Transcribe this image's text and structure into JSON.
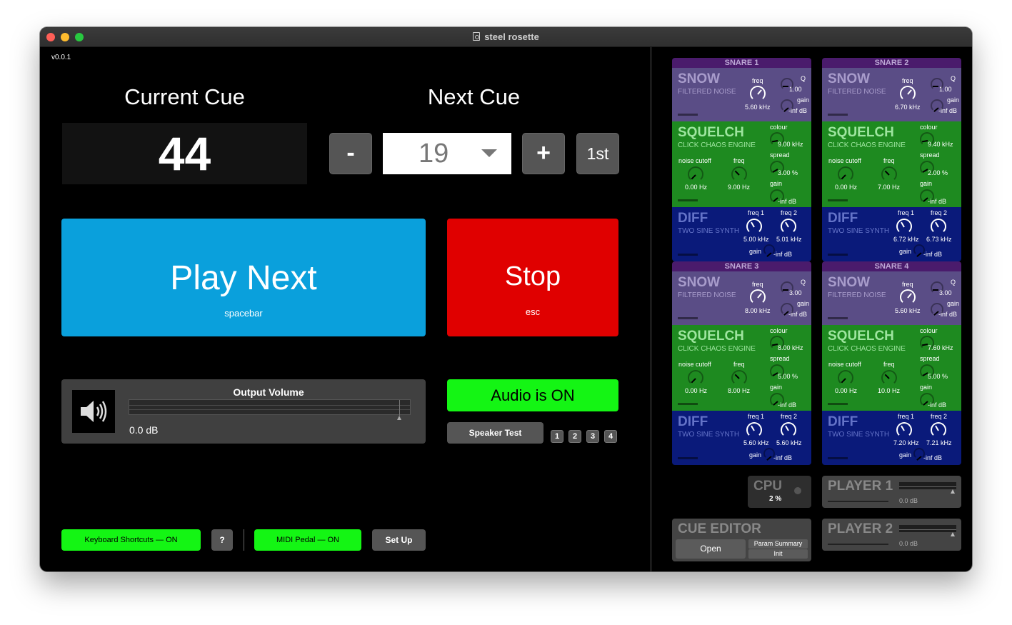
{
  "window": {
    "title": "steel rosette",
    "version": "v0.0.1"
  },
  "cues": {
    "current_label": "Current Cue",
    "next_label": "Next Cue",
    "current_value": "44",
    "next_value": "19",
    "minus_label": "-",
    "plus_label": "+",
    "first_label": "1st"
  },
  "transport": {
    "play_label": "Play Next",
    "play_hint": "spacebar",
    "stop_label": "Stop",
    "stop_hint": "esc"
  },
  "output": {
    "title": "Output Volume",
    "value": "0.0 dB"
  },
  "audio": {
    "status": "Audio is ON",
    "speaker_test": "Speaker Test",
    "channels": [
      "1",
      "2",
      "3",
      "4"
    ]
  },
  "bottom": {
    "keyboard": "Keyboard Shortcuts — ON",
    "help": "?",
    "midi": "MIDI Pedal — ON",
    "setup": "Set Up"
  },
  "snares": [
    {
      "header": "SNARE 1",
      "snow": {
        "title": "SNOW",
        "sub": "FILTERED NOISE",
        "freq_label": "freq",
        "freq": "5.60 kHz",
        "q_label": "Q",
        "q": "1.00",
        "gain_label": "gain",
        "gain": "-inf dB"
      },
      "squelch": {
        "title": "SQUELCH",
        "sub": "CLICK CHAOS ENGINE",
        "colour_label": "colour",
        "colour": "9.00 kHz",
        "noise_label": "noise cutoff",
        "noise": "0.00 Hz",
        "freq_label": "freq",
        "freq": "9.00 Hz",
        "spread_label": "spread",
        "spread": "3.00 %",
        "gain_label": "gain",
        "gain": "-inf dB"
      },
      "diff": {
        "title": "DIFF",
        "sub": "TWO SINE SYNTH",
        "f1_label": "freq 1",
        "f1": "5.00 kHz",
        "f2_label": "freq 2",
        "f2": "5.01 kHz",
        "gain_label": "gain",
        "gain": "-inf dB"
      }
    },
    {
      "header": "SNARE 2",
      "snow": {
        "title": "SNOW",
        "sub": "FILTERED NOISE",
        "freq_label": "freq",
        "freq": "6.70 kHz",
        "q_label": "Q",
        "q": "1.00",
        "gain_label": "gain",
        "gain": "-inf dB"
      },
      "squelch": {
        "title": "SQUELCH",
        "sub": "CLICK CHAOS ENGINE",
        "colour_label": "colour",
        "colour": "9.40 kHz",
        "noise_label": "noise cutoff",
        "noise": "0.00 Hz",
        "freq_label": "freq",
        "freq": "7.00 Hz",
        "spread_label": "spread",
        "spread": "2.00 %",
        "gain_label": "gain",
        "gain": "-inf dB"
      },
      "diff": {
        "title": "DIFF",
        "sub": "TWO SINE SYNTH",
        "f1_label": "freq 1",
        "f1": "6.72 kHz",
        "f2_label": "freq 2",
        "f2": "6.73 kHz",
        "gain_label": "gain",
        "gain": "-inf dB"
      }
    },
    {
      "header": "SNARE 3",
      "snow": {
        "title": "SNOW",
        "sub": "FILTERED NOISE",
        "freq_label": "freq",
        "freq": "8.00 kHz",
        "q_label": "Q",
        "q": "3.00",
        "gain_label": "gain",
        "gain": "-inf dB"
      },
      "squelch": {
        "title": "SQUELCH",
        "sub": "CLICK CHAOS ENGINE",
        "colour_label": "colour",
        "colour": "8.00 kHz",
        "noise_label": "noise cutoff",
        "noise": "0.00 Hz",
        "freq_label": "freq",
        "freq": "8.00 Hz",
        "spread_label": "spread",
        "spread": "5.00 %",
        "gain_label": "gain",
        "gain": "-inf dB"
      },
      "diff": {
        "title": "DIFF",
        "sub": "TWO SINE SYNTH",
        "f1_label": "freq 1",
        "f1": "5.60 kHz",
        "f2_label": "freq 2",
        "f2": "5.60 kHz",
        "gain_label": "gain",
        "gain": "-inf dB"
      }
    },
    {
      "header": "SNARE 4",
      "snow": {
        "title": "SNOW",
        "sub": "FILTERED NOISE",
        "freq_label": "freq",
        "freq": "5.60 kHz",
        "q_label": "Q",
        "q": "3.00",
        "gain_label": "gain",
        "gain": "-inf dB"
      },
      "squelch": {
        "title": "SQUELCH",
        "sub": "CLICK CHAOS ENGINE",
        "colour_label": "colour",
        "colour": "7.60 kHz",
        "noise_label": "noise cutoff",
        "noise": "0.00 Hz",
        "freq_label": "freq",
        "freq": "10.0 Hz",
        "spread_label": "spread",
        "spread": "5.00 %",
        "gain_label": "gain",
        "gain": "-inf dB"
      },
      "diff": {
        "title": "DIFF",
        "sub": "TWO SINE SYNTH",
        "f1_label": "freq 1",
        "f1": "7.20 kHz",
        "f2_label": "freq 2",
        "f2": "7.21 kHz",
        "gain_label": "gain",
        "gain": "-inf dB"
      }
    }
  ],
  "cpu": {
    "title": "CPU",
    "value": "2 %"
  },
  "players": [
    {
      "title": "PLAYER 1",
      "value": "0.0 dB"
    },
    {
      "title": "PLAYER 2",
      "value": "0.0 dB"
    }
  ],
  "cue_editor": {
    "title": "CUE EDITOR",
    "open": "Open",
    "param_summary": "Param Summary",
    "init": "Init"
  },
  "colors": {
    "play": "#0aa0dc",
    "stop": "#e00000",
    "green": "#14f514",
    "snow": "#5a4d86",
    "squelch": "#1e8a20",
    "diff": "#0a1a7a",
    "snare_header": "#4a1b6c"
  }
}
